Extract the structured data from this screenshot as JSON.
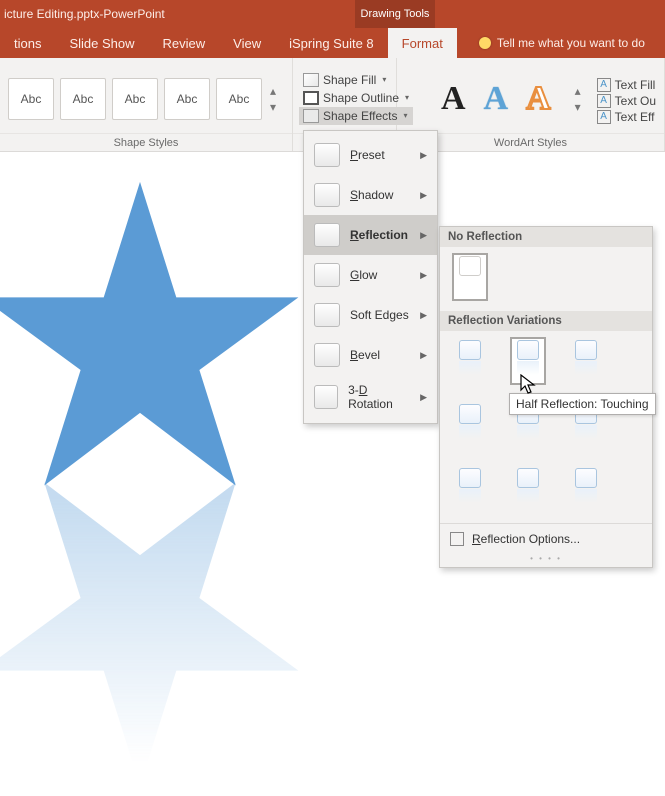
{
  "title": {
    "doc": "icture Editing.pptx",
    "app_sep": " - ",
    "app": "PowerPoint",
    "drawing_tools": "Drawing Tools"
  },
  "tabs": {
    "t0": "tions",
    "t1": "Slide Show",
    "t2": "Review",
    "t3": "View",
    "t4": "iSpring Suite 8",
    "t5": "Format",
    "tellme": "Tell me what you want to do"
  },
  "groups": {
    "shape_styles": "Shape Styles",
    "wordart_styles": "WordArt Styles"
  },
  "gallery_label": "Abc",
  "shape_cmds": {
    "fill": "Shape Fill",
    "outline": "Shape Outline",
    "effects": "Shape Effects"
  },
  "text_cmds": {
    "fill": "Text Fill",
    "outline": "Text Ou",
    "effects": "Text Eff"
  },
  "wa_glyph": "A",
  "effects_menu": {
    "preset": "reset",
    "preset_pre": "P",
    "shadow": "hadow",
    "shadow_pre": "S",
    "reflection": "eflection",
    "reflection_pre": "R",
    "glow": "low",
    "glow_pre": "G",
    "softedges": "Soft Edges",
    "bevel": "evel",
    "bevel_pre": "B",
    "rotation_pre": "3-",
    "rotation_u": "D",
    "rotation_post": " Rotation"
  },
  "refl": {
    "no_reflection": "No Reflection",
    "variations": "Reflection Variations",
    "options_pre": "",
    "options_u": "R",
    "options_post": "eflection Options..."
  },
  "tooltip": "Half Reflection: Touching"
}
